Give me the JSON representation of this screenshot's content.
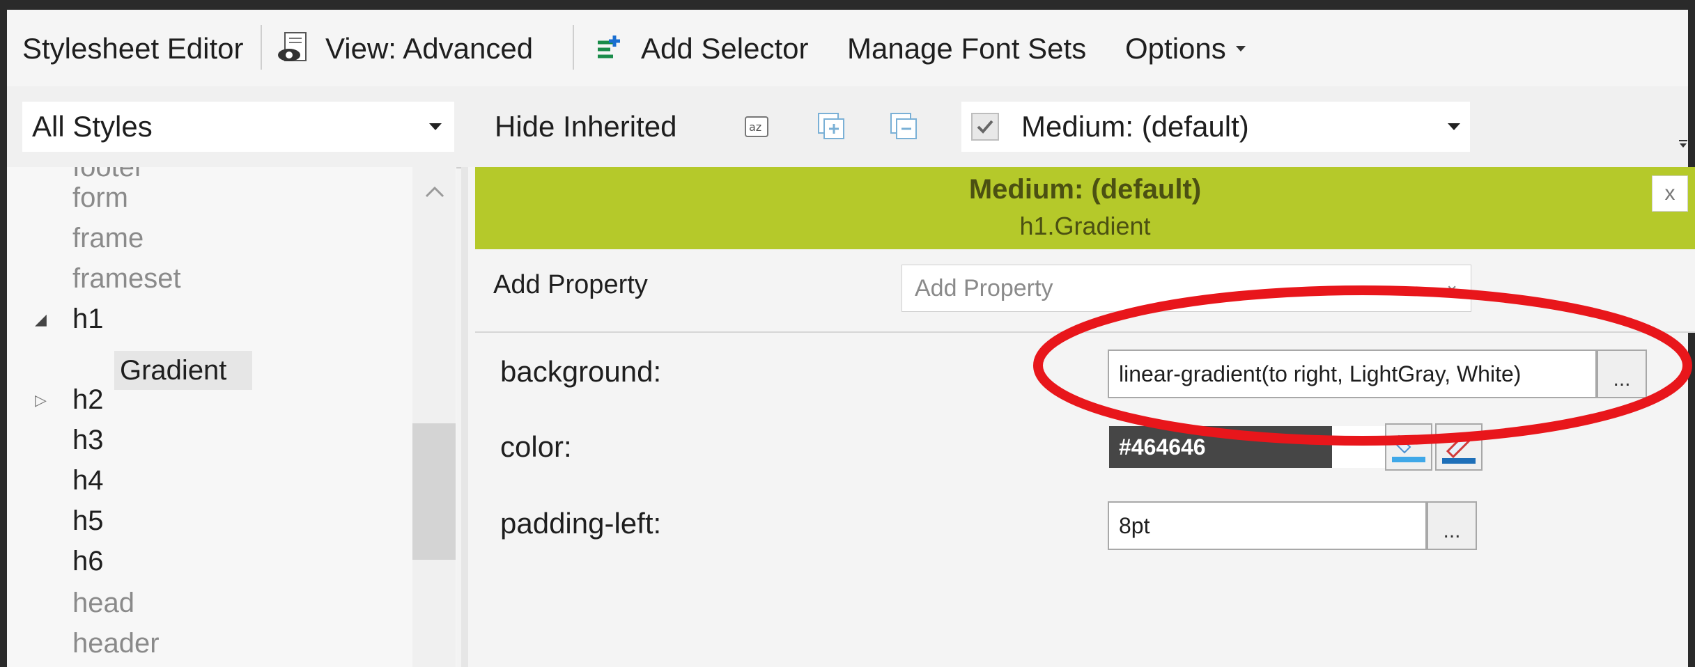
{
  "toolbar": {
    "title": "Stylesheet Editor",
    "view_label": "View: Advanced",
    "add_selector_label": "Add Selector",
    "manage_fonts_label": "Manage Font Sets",
    "options_label": "Options"
  },
  "filterbar": {
    "styles_combo_value": "All Styles",
    "hide_inherited_label": "Hide Inherited",
    "medium_combo_value": "Medium: (default)"
  },
  "tree": {
    "items": [
      {
        "label": "footer",
        "muted": true
      },
      {
        "label": "form",
        "muted": true
      },
      {
        "label": "frame",
        "muted": true
      },
      {
        "label": "frameset",
        "muted": true
      },
      {
        "label": "h1",
        "muted": false
      },
      {
        "label": "Gradient",
        "muted": false
      },
      {
        "label": "h2",
        "muted": false
      },
      {
        "label": "h3",
        "muted": false
      },
      {
        "label": "h4",
        "muted": false
      },
      {
        "label": "h5",
        "muted": false
      },
      {
        "label": "h6",
        "muted": false
      },
      {
        "label": "head",
        "muted": true
      },
      {
        "label": "header",
        "muted": true
      }
    ]
  },
  "editor": {
    "header_title": "Medium: (default)",
    "header_subtitle": "h1.Gradient",
    "close_label": "x",
    "add_property_label": "Add Property",
    "add_property_placeholder": "Add Property",
    "properties": [
      {
        "name": "background:",
        "value": "linear-gradient(to right, LightGray, White)",
        "button": "..."
      },
      {
        "name": "color:",
        "value": "#464646"
      },
      {
        "name": "padding-left:",
        "value": "8pt",
        "button": "..."
      }
    ]
  },
  "colors": {
    "header_band": "#b5c92a",
    "annotation_ellipse": "#e8161b",
    "color_swatch": "#464646"
  }
}
